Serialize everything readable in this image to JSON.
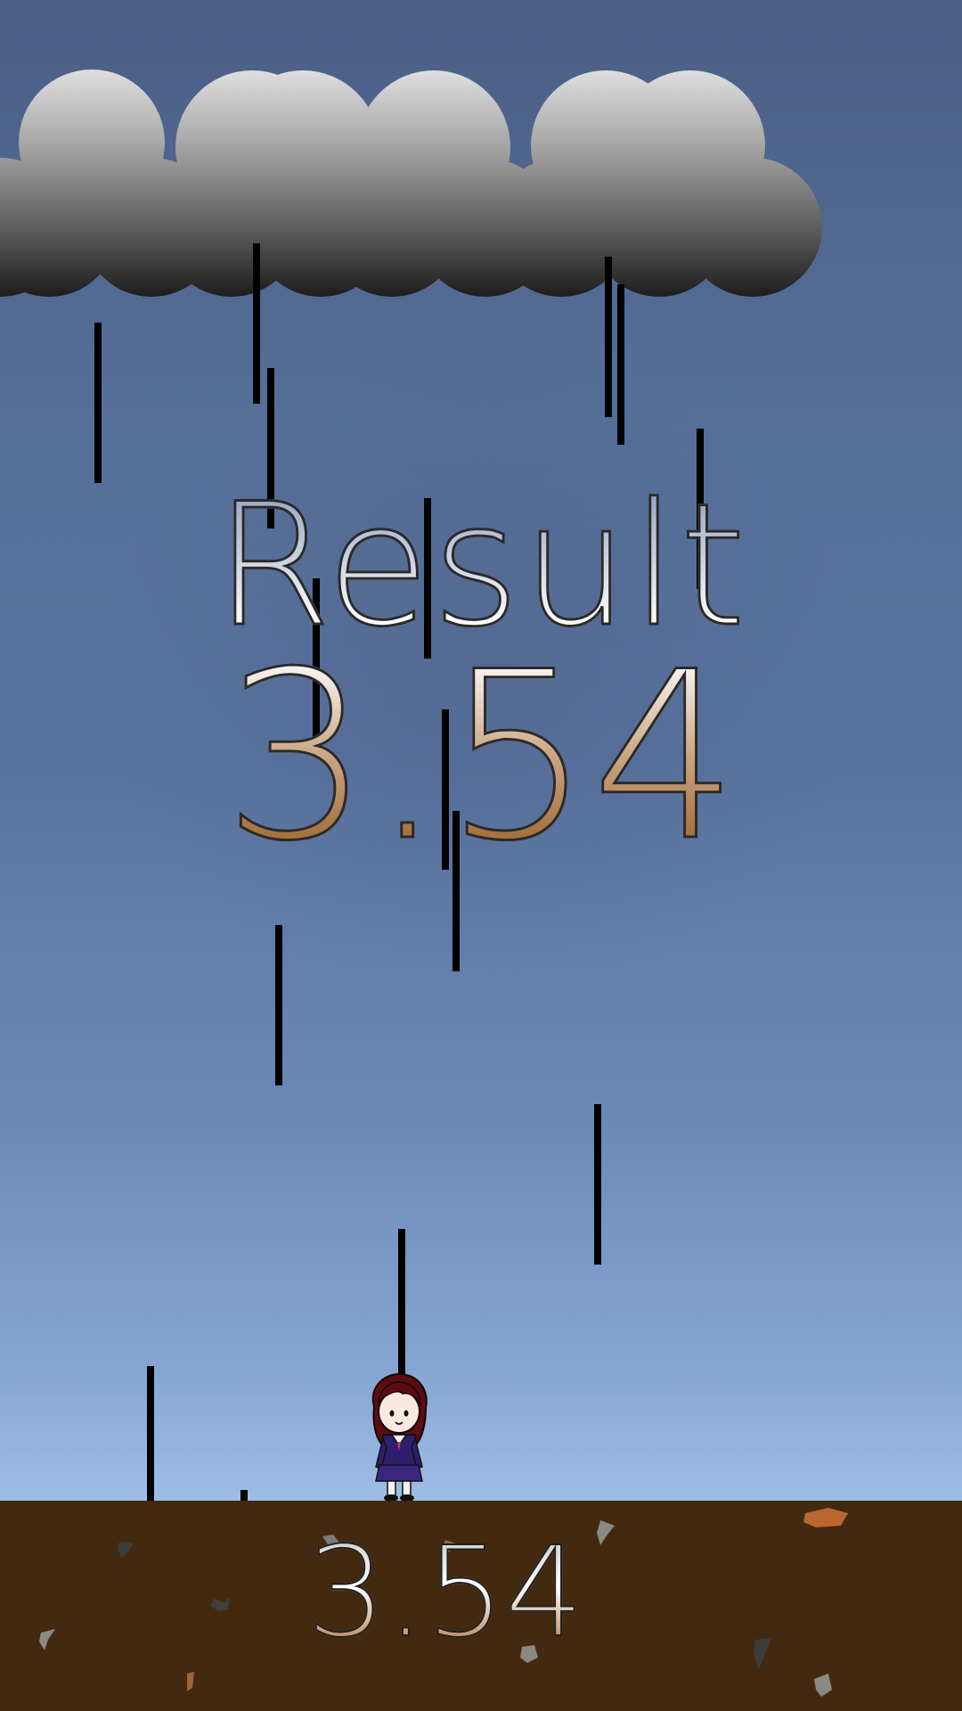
{
  "result": {
    "title": "Result",
    "score": "3.54"
  },
  "ground": {
    "score": "3.54"
  },
  "colors": {
    "sky_top": "#4a5f86",
    "sky_bottom": "#9dbde5",
    "ground": "#43290f",
    "rain": "#000000"
  }
}
